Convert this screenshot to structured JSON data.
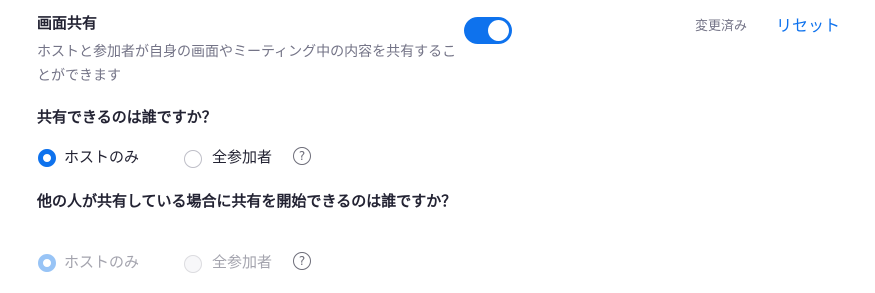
{
  "setting": {
    "title": "画面共有",
    "description": "ホストと参加者が自身の画面やミーティング中の内容を共有することができます",
    "toggle_on": true,
    "status": "変更済み",
    "reset_label": "リセット"
  },
  "question1": {
    "label": "共有できるのは誰ですか？",
    "options": [
      {
        "label": "ホストのみ",
        "checked": true
      },
      {
        "label": "全参加者",
        "checked": false
      }
    ],
    "help_icon": "question-circle-icon",
    "help_glyph": "?"
  },
  "question2": {
    "label": "他の人が共有している場合に共有を開始できるのは誰ですか？",
    "disabled": true,
    "options": [
      {
        "label": "ホストのみ",
        "checked": true
      },
      {
        "label": "全参加者",
        "checked": false
      }
    ],
    "help_icon": "question-circle-icon",
    "help_glyph": "?"
  },
  "colors": {
    "accent": "#0e72ed",
    "text_primary": "#232333",
    "text_secondary": "#747487"
  }
}
